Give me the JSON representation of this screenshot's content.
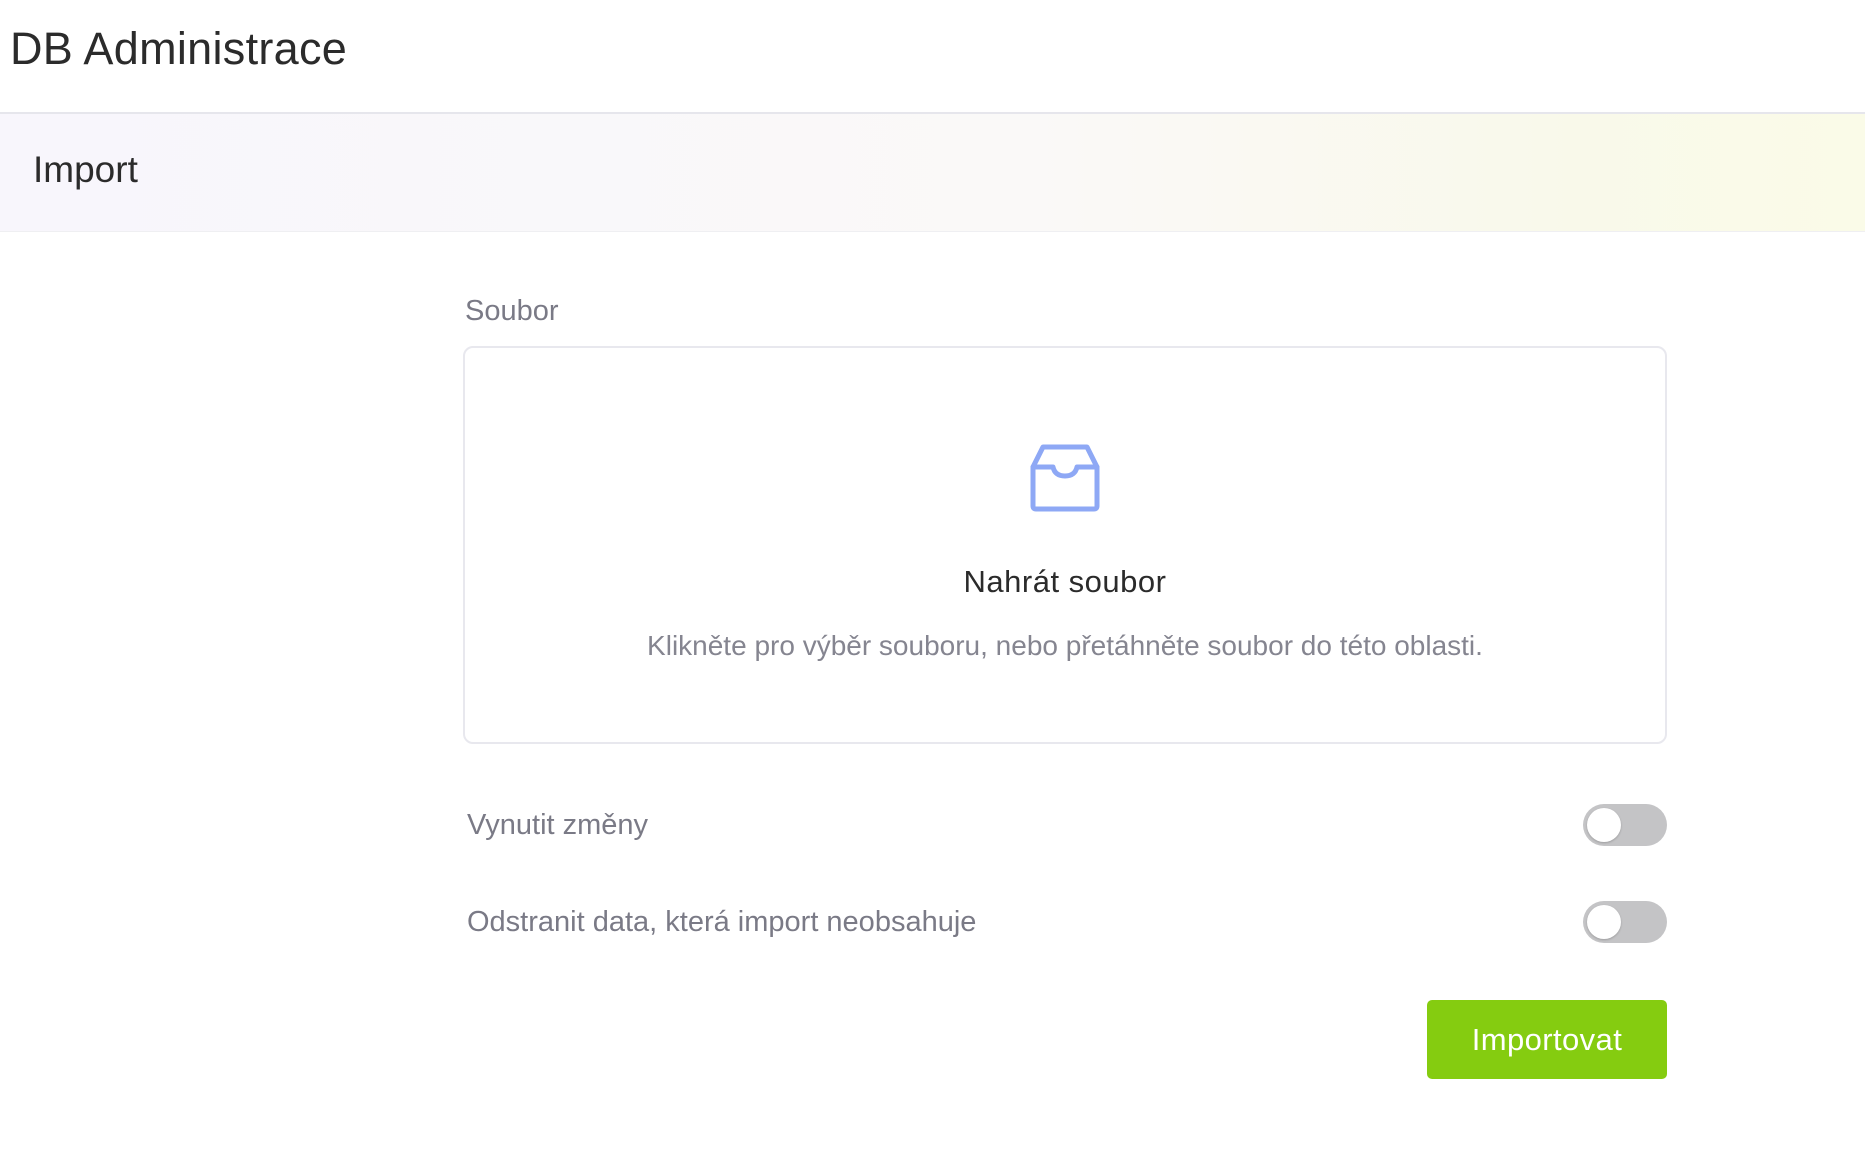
{
  "app": {
    "title": "DB Administrace"
  },
  "page": {
    "title": "Import"
  },
  "form": {
    "file_label": "Soubor",
    "dropzone": {
      "icon": "inbox-icon",
      "title": "Nahrát soubor",
      "hint": "Klikněte pro výběr souboru, nebo přetáhněte soubor do této oblasti."
    },
    "switches": [
      {
        "label": "Vynutit změny",
        "checked": false
      },
      {
        "label": "Odstranit data, která import neobsahuje",
        "checked": false
      }
    ],
    "submit_label": "Importovat"
  },
  "colors": {
    "accent": "#85cc10",
    "icon": "#8ea8f5",
    "toggle_off": "#c4c4c6"
  }
}
